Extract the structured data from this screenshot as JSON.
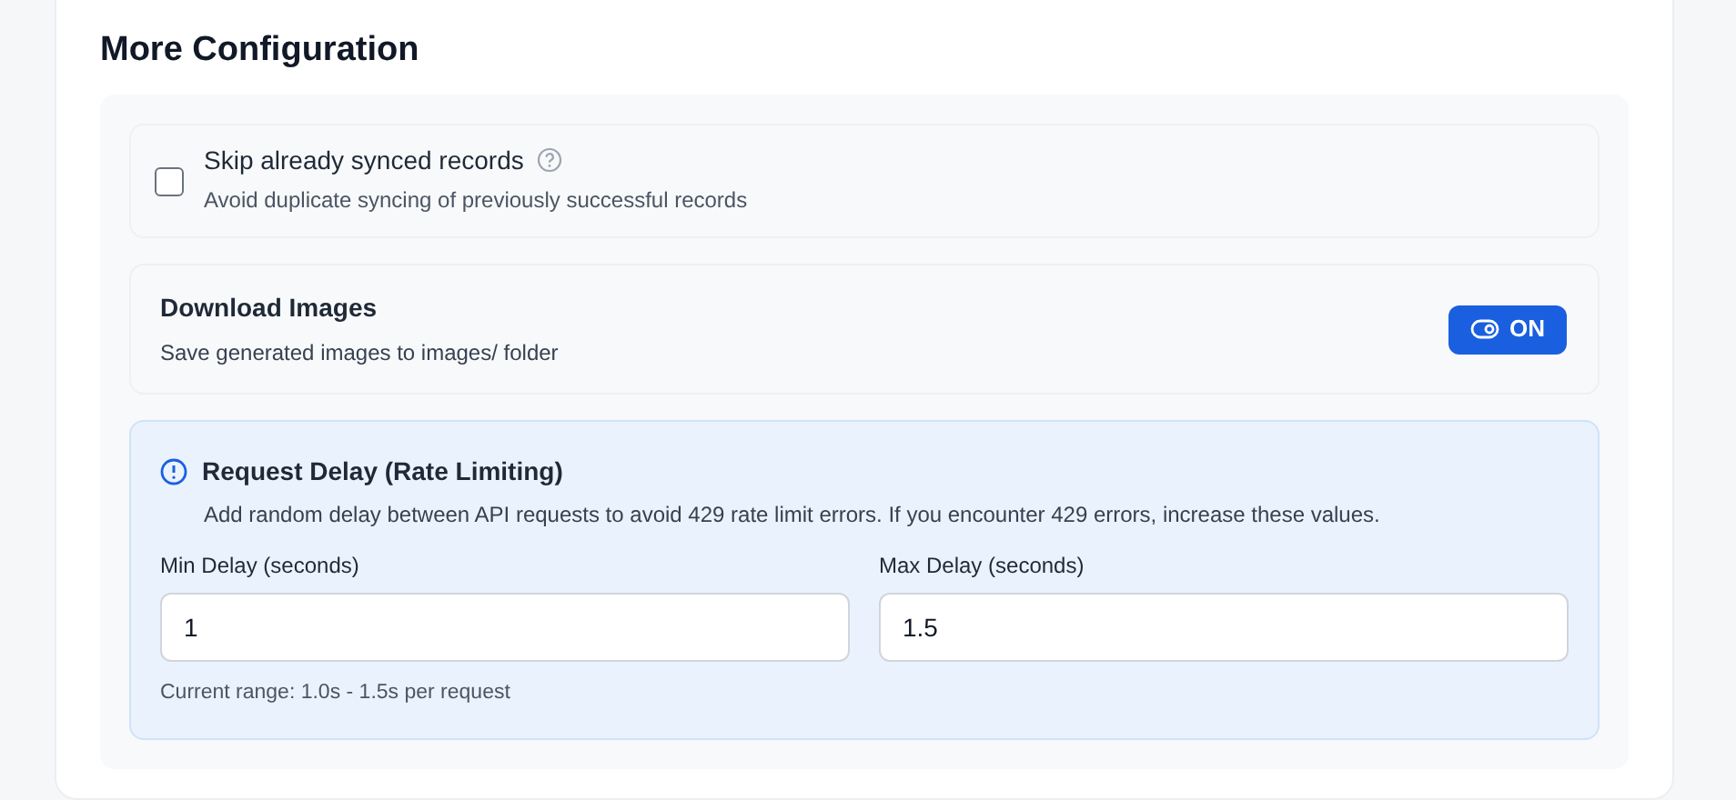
{
  "section_title": "More Configuration",
  "skip_synced": {
    "label": "Skip already synced records",
    "description": "Avoid duplicate syncing of previously successful records",
    "checked": false
  },
  "download_images": {
    "label": "Download Images",
    "description": "Save generated images to images/ folder",
    "on": true,
    "state_text": "ON"
  },
  "request_delay": {
    "title": "Request Delay (Rate Limiting)",
    "description": "Add random delay between API requests to avoid 429 rate limit errors. If you encounter 429 errors, increase these values.",
    "fields": [
      {
        "label": "Min Delay (seconds)",
        "value": "1"
      },
      {
        "label": "Max Delay (seconds)",
        "value": "1.5"
      }
    ],
    "hint": "Current range: 1.0s - 1.5s per request"
  }
}
